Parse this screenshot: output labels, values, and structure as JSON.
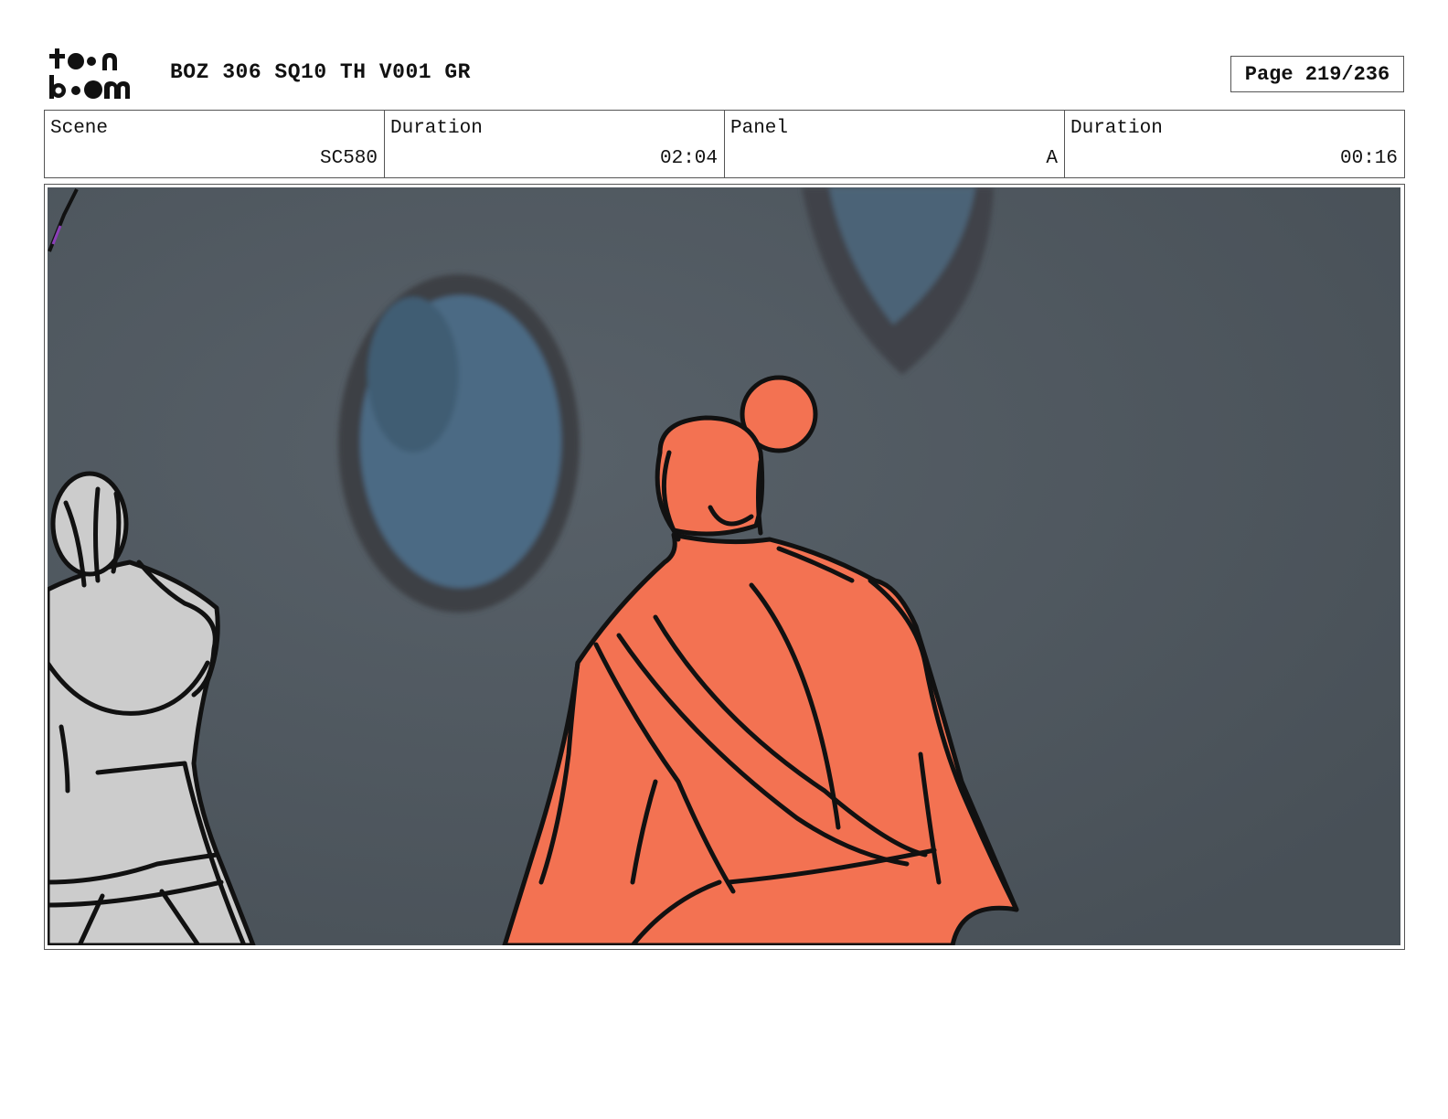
{
  "header": {
    "logo_text": "toon boom",
    "project_title": "BOZ 306 SQ10 TH V001 GR",
    "page_label": "Page 219/236"
  },
  "info": {
    "scene_label": "Scene",
    "scene_value": "SC580",
    "scene_duration_label": "Duration",
    "scene_duration_value": "02:04",
    "panel_label": "Panel",
    "panel_value": "A",
    "panel_duration_label": "Duration",
    "panel_duration_value": "00:16"
  },
  "panel": {
    "background_color": "#4f5860",
    "figure_color": "#f37252",
    "secondary_figure_color": "#cccccc"
  }
}
